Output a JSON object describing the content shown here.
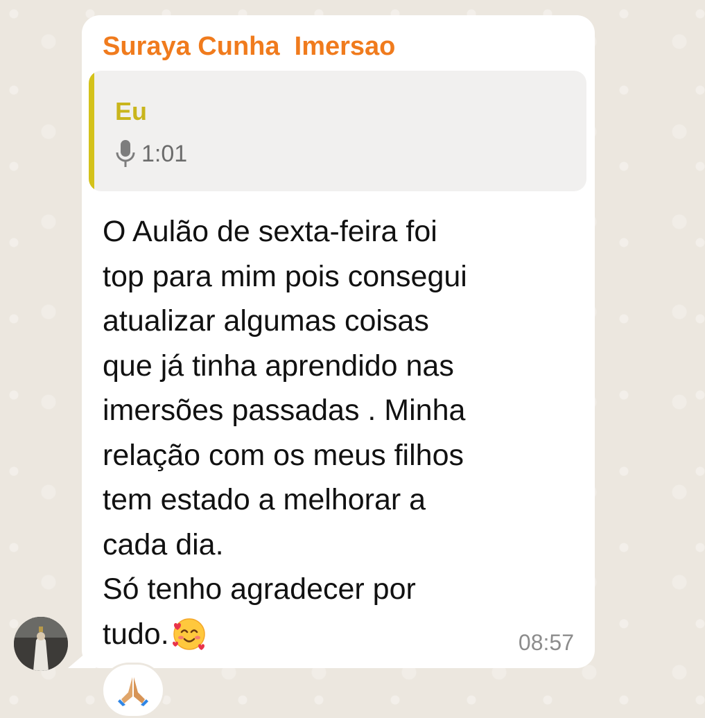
{
  "message": {
    "sender_name": "Suraya Cunha  Imersao",
    "quoted": {
      "author": "Eu",
      "icon": "microphone-icon",
      "duration": "1:01"
    },
    "lines": [
      "O Aulão de sexta-feira foi",
      "top para mim pois consegui",
      "atualizar algumas coisas",
      "que já tinha aprendido nas",
      "imersões passadas . Minha",
      "relação com os meus filhos",
      "tem estado a melhorar a",
      "cada dia.",
      "Só tenho agradecer por",
      "tudo."
    ],
    "emoji": "smiling-face-with-hearts-icon",
    "time": "08:57"
  },
  "reaction": {
    "icon": "folded-hands-icon"
  },
  "colors": {
    "sender": "#f07b1d",
    "quote_author": "#c9b51c",
    "quote_bar": "#d4c21a",
    "chat_background": "#ece7df"
  }
}
